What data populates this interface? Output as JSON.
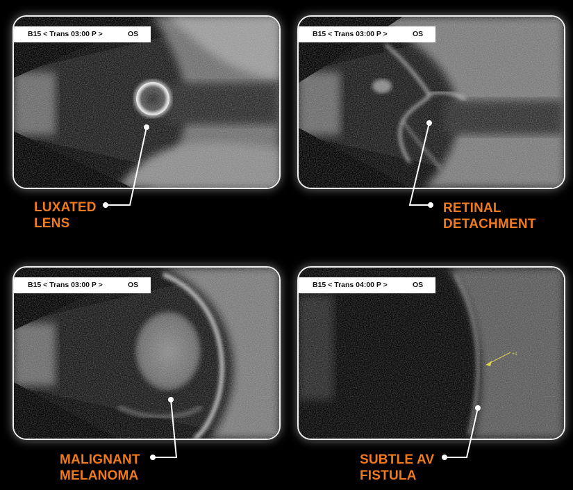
{
  "panels": [
    {
      "probe": "B15 < Trans 03:00 P >",
      "eye": "OS",
      "label_lines": [
        "LUXATED",
        "LENS"
      ]
    },
    {
      "probe": "B15 < Trans 03:00 P >",
      "eye": "OS",
      "label_lines": [
        "RETINAL",
        "DETACHMENT"
      ]
    },
    {
      "probe": "B15 < Trans 03:00 P >",
      "eye": "OS",
      "label_lines": [
        "MALIGNANT",
        "MELANOMA"
      ]
    },
    {
      "probe": "B15 < Trans 04:00 P >",
      "eye": "OS",
      "label_lines": [
        "SUBTLE AV",
        "FISTULA"
      ]
    }
  ],
  "measurement_marker": "+1",
  "colors": {
    "label": "#f07a1e",
    "frame": "#f2f2f2",
    "background": "#000000",
    "marker": "#d9d23a"
  }
}
